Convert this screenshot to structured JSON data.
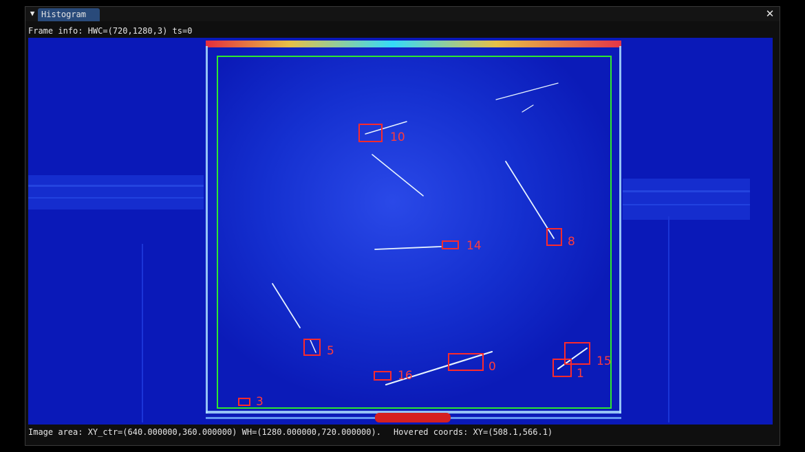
{
  "window": {
    "title": "Histogram",
    "collapse_icon": "triangle-down-icon",
    "close_icon": "close-icon",
    "close_glyph": "✕",
    "collapse_glyph": "▼"
  },
  "frame_info": "Frame info: HWC=(720,1280,3) ts=0",
  "status": {
    "image_area": "Image area: XY_ctr=(640.000000,360.000000) WH=(1280.000000,720.000000).",
    "hovered": "Hovered coords: XY=(508.1,566.1)"
  },
  "colors": {
    "background_field": "#0a19b8",
    "roi_border": "#2ee82e",
    "detection_box": "#ff2a2a",
    "track_highlight": "#e8f4ff"
  },
  "detections": [
    {
      "id": "10"
    },
    {
      "id": "14"
    },
    {
      "id": "8"
    },
    {
      "id": "5"
    },
    {
      "id": "16"
    },
    {
      "id": "0"
    },
    {
      "id": "1"
    },
    {
      "id": "15"
    },
    {
      "id": "3"
    }
  ]
}
